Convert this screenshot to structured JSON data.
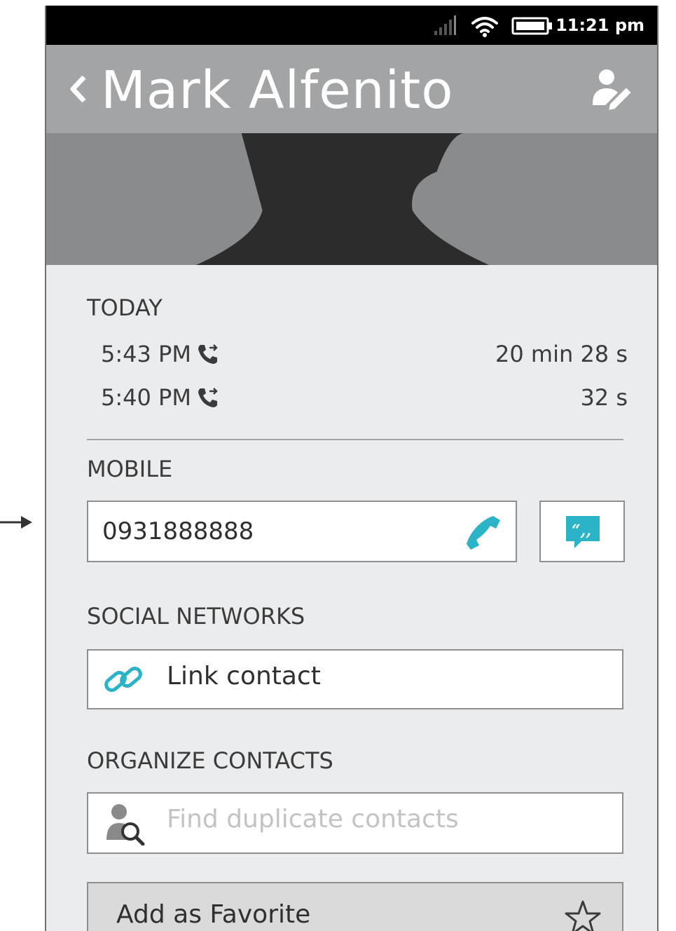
{
  "status_bar": {
    "time": "11:21 pm"
  },
  "header": {
    "title": "Mark Alfenito"
  },
  "call_log": {
    "heading": "TODAY",
    "calls": [
      {
        "time": "5:43 PM",
        "duration": "20 min 28 s"
      },
      {
        "time": "5:40 PM",
        "duration": "32 s"
      }
    ]
  },
  "mobile": {
    "heading": "MOBILE",
    "number": "0931888888"
  },
  "social": {
    "heading": "SOCIAL NETWORKS",
    "link_label": "Link contact"
  },
  "organize": {
    "heading": "ORGANIZE CONTACTS",
    "find_duplicates_label": "Find duplicate contacts"
  },
  "favorite": {
    "label": "Add as Favorite"
  },
  "icons": {
    "status": [
      "signal-icon",
      "wifi-icon",
      "battery-icon"
    ],
    "header": [
      "back-chevron-icon",
      "edit-contact-icon"
    ],
    "actions": [
      "outgoing-call-icon",
      "phone-dial-icon",
      "sms-icon",
      "link-icon",
      "find-duplicates-icon",
      "star-icon"
    ]
  },
  "colors": {
    "accent": "#2bb3c8",
    "header_bg": "#a3a4a5",
    "page_bg": "#ebecee",
    "status_bg": "#000000"
  }
}
